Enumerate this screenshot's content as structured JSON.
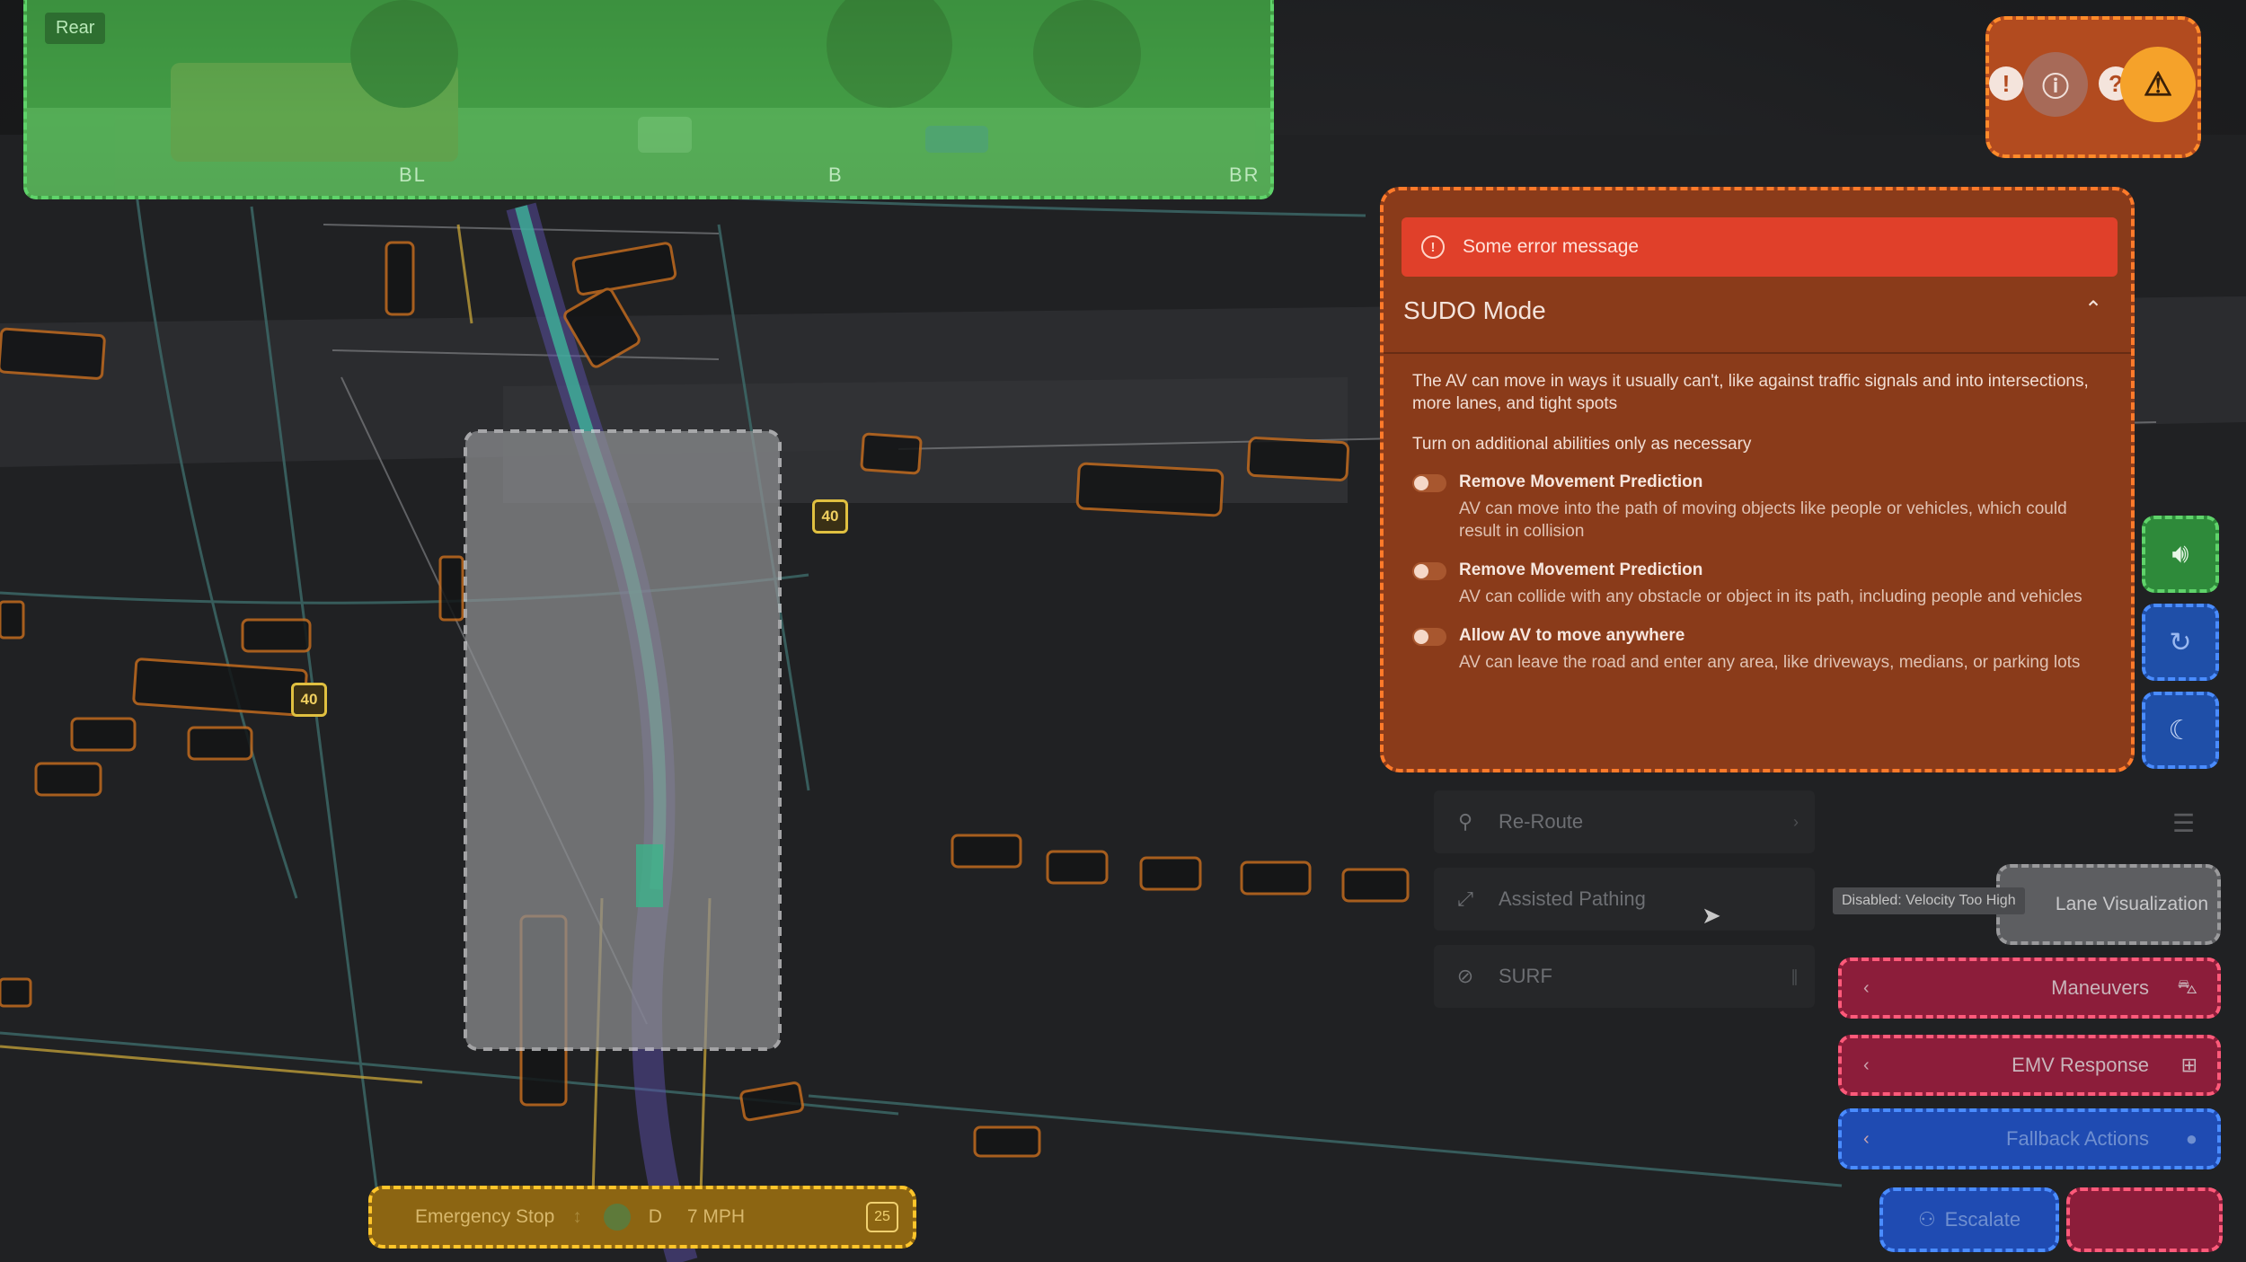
{
  "rear_camera": {
    "tag": "Rear",
    "labels": [
      "BL",
      "B",
      "BR"
    ]
  },
  "alerts": {
    "icons": [
      "exclamation-icon",
      "exclamation-circle-icon",
      "question-icon",
      "warning-triangle-icon"
    ],
    "accent": "#f5a22a"
  },
  "sudo_panel": {
    "error_message": "Some error message",
    "title": "SUDO Mode",
    "description": "The AV can move in ways it usually can't, like against traffic signals and into intersections, more lanes, and tight spots",
    "instruction": "Turn on additional abilities only as necessary",
    "options": [
      {
        "title": "Remove Movement Prediction",
        "description": "AV can move into the path of moving objects like people or vehicles, which could result in collision",
        "enabled": false
      },
      {
        "title": "Remove Movement Prediction",
        "description": "AV can collide with any obstacle or object in its path, including people and vehicles",
        "enabled": false
      },
      {
        "title": "Allow AV to move anywhere",
        "description": "AV can leave the road and enter any area, like driveways, medians, or parking lots",
        "enabled": false
      }
    ]
  },
  "side_buttons": [
    {
      "icon": "speaker-icon",
      "color": "#2e8a3a"
    },
    {
      "icon": "refresh-icon",
      "color": "#1f4fa8"
    },
    {
      "icon": "moon-icon",
      "color": "#1f4fa8"
    }
  ],
  "menu_items": [
    {
      "label": "Re-Route",
      "icon": "person-pin-icon"
    },
    {
      "label": "Assisted Pathing",
      "icon": "path-icon"
    },
    {
      "label": "SURF",
      "icon": "no-entry-icon"
    }
  ],
  "tooltip": "Disabled: Velocity Too High",
  "lane_visualization": "Lane Visualization",
  "actions": [
    {
      "label": "Maneuvers",
      "icon": "car-icon"
    },
    {
      "label": "EMV Response",
      "icon": "plus-box-icon"
    },
    {
      "label": "Fallback Actions",
      "icon": "dot-icon"
    }
  ],
  "escalate": "Escalate",
  "status_bar": {
    "emergency_stop": "Emergency Stop",
    "gear": "D",
    "speed": "7 MPH",
    "speed_limit": "25"
  },
  "speed_signs": [
    "40",
    "40"
  ]
}
